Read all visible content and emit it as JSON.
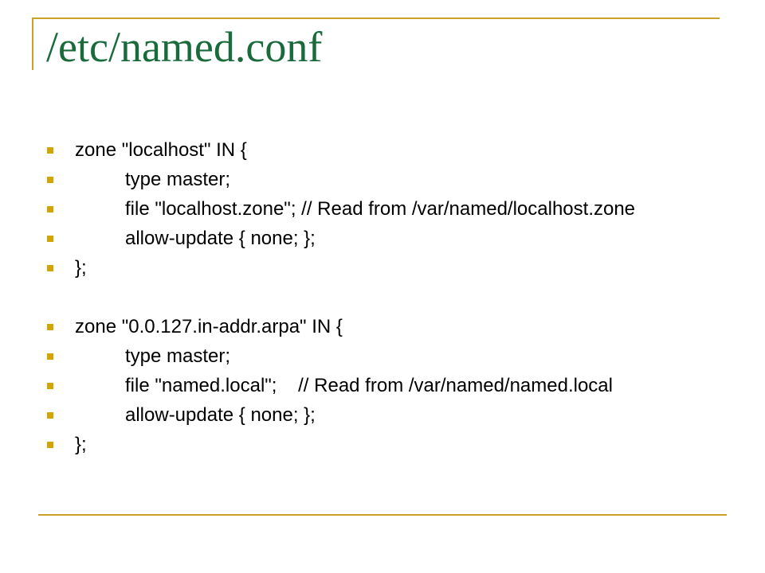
{
  "slide": {
    "title": "/etc/named.conf",
    "colors": {
      "title": "#1a6b3c",
      "rule": "#c9a227",
      "bullet": "#d4a500",
      "text": "#000000"
    },
    "bullet_icon": "square-bullet-icon"
  },
  "zones": [
    {
      "lines": [
        "zone \"localhost\" IN {",
        "type master;",
        "file \"localhost.zone\"; // Read from /var/named/localhost.zone",
        "allow-update { none; };",
        "};"
      ]
    },
    {
      "lines": [
        "zone \"0.0.127.in-addr.arpa\" IN {",
        "type master;",
        "file \"named.local\";    // Read from /var/named/named.local",
        "allow-update { none; };",
        "};"
      ]
    }
  ]
}
